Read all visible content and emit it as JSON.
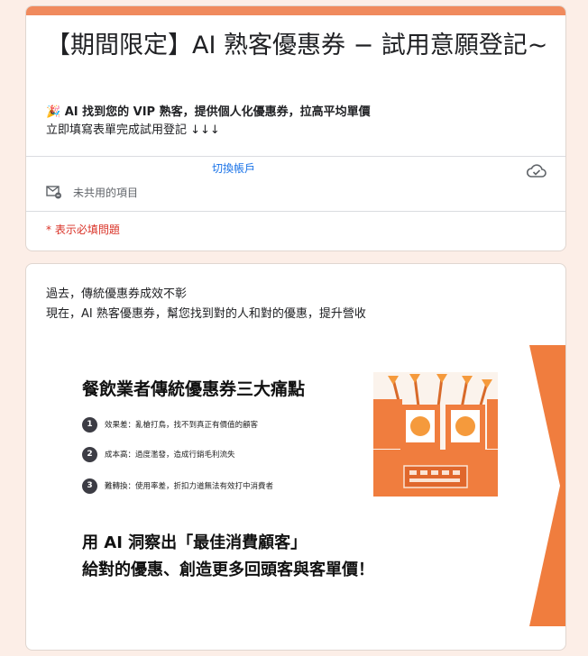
{
  "colors": {
    "page_background": "#fceee7",
    "accent": "#f08a5d",
    "link": "#1a73e8",
    "required": "#d93025",
    "banner_orange": "#f07d3e"
  },
  "header": {
    "title": "【期間限定】AI 熟客優惠券 − 試用意願登記~",
    "description_line1": "🎉 AI 找到您的 VIP 熟客，提供個人化優惠券，拉高平均單價",
    "description_line2": "立即填寫表單完成試用登記 ↓↓↓",
    "switch_account": "切換帳戶",
    "cloud_icon": "cloud-check-icon",
    "not_shared_icon": "mail-not-shared-icon",
    "not_shared": "未共用的項目",
    "required_note": "* 表示必填問題"
  },
  "intro": {
    "line1": "過去，傳統優惠券成效不彰",
    "line2": "現在，AI 熟客優惠券，幫您找到對的人和對的優惠，提升營收"
  },
  "banner": {
    "heading": "餐飲業者傳統優惠券三大痛點",
    "points": [
      {
        "num": "1",
        "text": "效果差：亂槍打鳥，找不到真正有價值的顧客"
      },
      {
        "num": "2",
        "text": "成本高：過度濫發，造成行銷毛利流失"
      },
      {
        "num": "3",
        "text": "難轉換：使用率差，折扣力道無法有效打中消費者"
      }
    ],
    "cta_line1": "用 AI 洞察出「最佳消費顧客」",
    "cta_line2": "給對的優惠、創造更多回頭客與客單價！",
    "illustration": "target-customers-illustration"
  }
}
